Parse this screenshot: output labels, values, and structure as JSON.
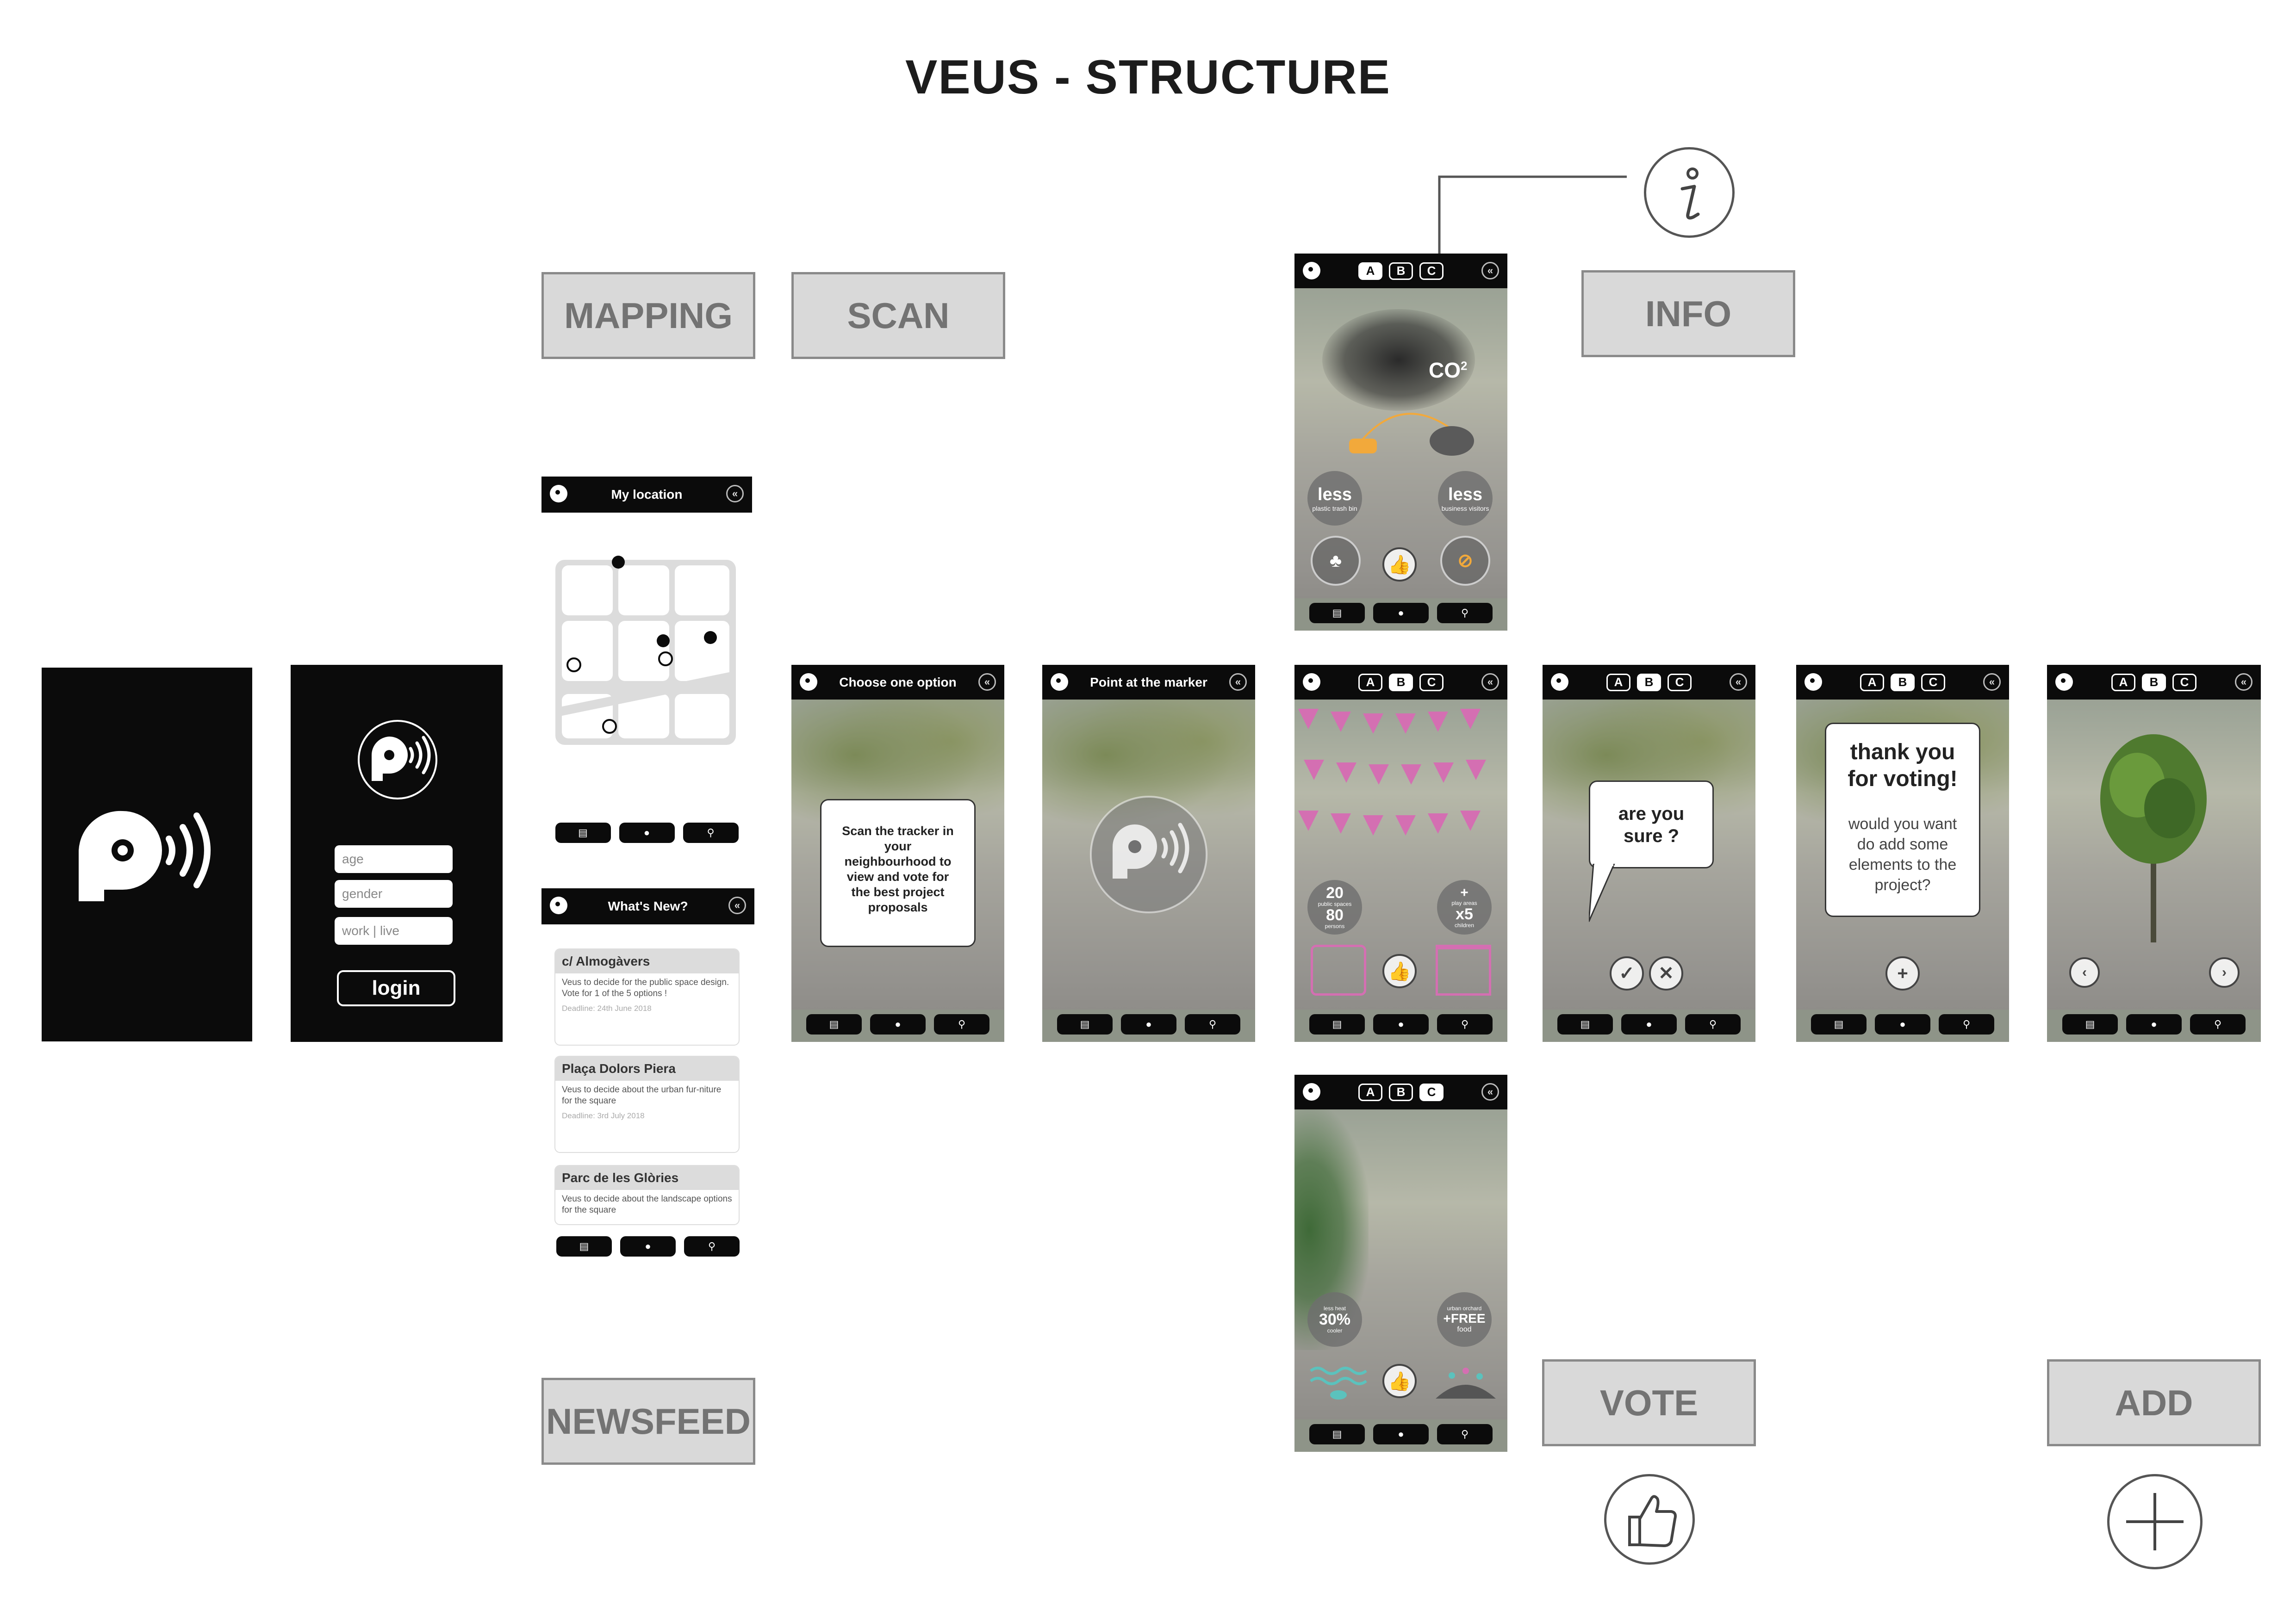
{
  "title": "VEUS - STRUCTURE",
  "sections": {
    "mapping": "MAPPING",
    "scan": "SCAN",
    "info": "INFO",
    "newsfeed": "NEWSFEED",
    "vote": "VOTE",
    "add": "ADD"
  },
  "login": {
    "age_placeholder": "age",
    "gender_placeholder": "gender",
    "work_placeholder": "work | live",
    "login_label": "login"
  },
  "map_screen": {
    "title": "My location"
  },
  "news_screen": {
    "title": "What's New?",
    "items": [
      {
        "title": "c/ Almogàvers",
        "body": "Veus to decide for the public space design. Vote for 1 of the 5 options !",
        "deadline": "Deadline: 24th June 2018"
      },
      {
        "title": "Plaça Dolors Piera",
        "body": "Veus to decide about the urban fur-niture for the square",
        "deadline": "Deadline: 3rd July 2018"
      },
      {
        "title": "Parc de les Glòries",
        "body": "Veus to decide about the landscape options for the square",
        "deadline": ""
      }
    ]
  },
  "choose_screen": {
    "title": "Choose one option",
    "card_text": "Scan the tracker in your neighbourhood to view and vote for the best project proposals"
  },
  "point_screen": {
    "title": "Point at the marker"
  },
  "tabs": [
    "A",
    "B",
    "C"
  ],
  "option_a": {
    "co2": "CO",
    "co2_sup": "2",
    "left_label": "less",
    "left_sub": "plastic trash bin",
    "right_label": "less",
    "right_sub": "business visitors"
  },
  "option_b": {
    "left_top": "20",
    "left_sub": "public spaces",
    "left_num": "80",
    "left_unit": "persons",
    "right_top": "+",
    "right_sub": "play areas",
    "right_num": "x5",
    "right_unit": "children"
  },
  "option_c": {
    "left_num": "30%",
    "left_sub": "less heat",
    "left_unit": "cooler",
    "right_top": "urban orchard",
    "right_num": "+FREE",
    "right_unit": "food"
  },
  "vote_screen": {
    "question": "are you sure ?"
  },
  "thanks_screen": {
    "headline": "thank you for voting!",
    "question": "would you want do add some elements to the project?"
  },
  "colors": {
    "section_bg": "#d9d9d9",
    "section_text": "#737373",
    "screen_black": "#0b0b0b",
    "pennant_pink": "#d46fb2",
    "accent_orange": "#f2a93b",
    "accent_teal": "#5bc2bd"
  },
  "icons": [
    "veus-logo-icon",
    "info-icon",
    "thumbs-up-icon",
    "plus-icon",
    "list-icon",
    "location-pin-icon",
    "search-icon",
    "back-icon",
    "check-icon",
    "cross-icon",
    "chevron-left-icon",
    "chevron-right-icon"
  ]
}
